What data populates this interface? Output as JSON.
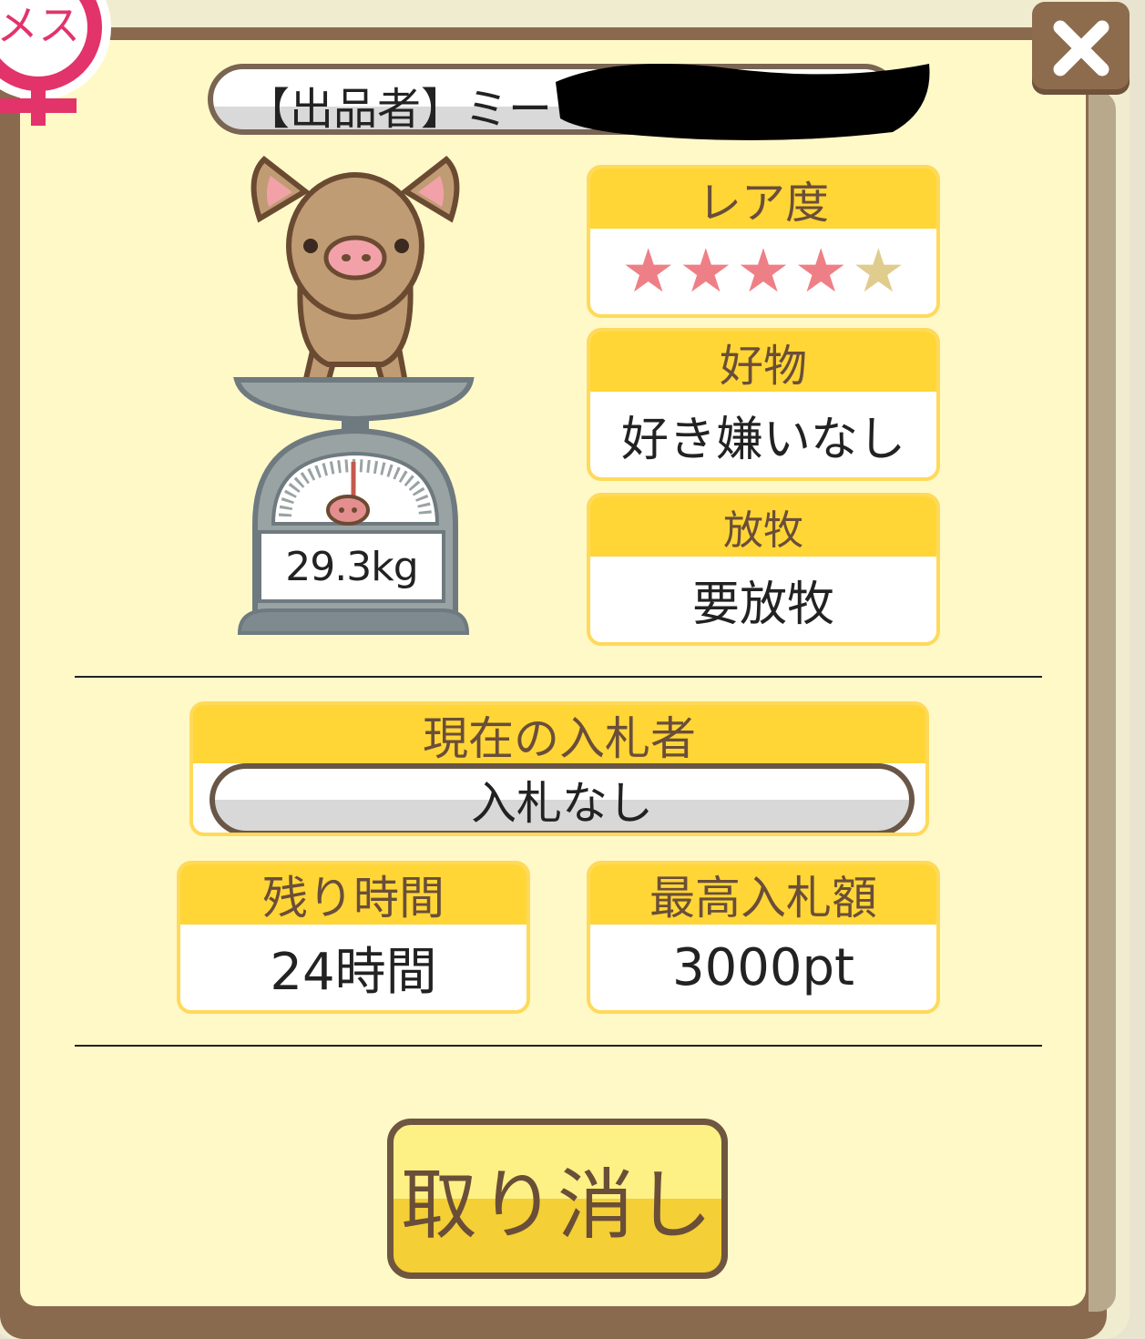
{
  "badge": {
    "label": "メス",
    "color": "#e2336a"
  },
  "seller": {
    "label": "【出品者】ミー"
  },
  "weight": "29.3kg",
  "rarity": {
    "label": "レア度",
    "filled": 4,
    "total": 5,
    "filled_color": "#ef7f86",
    "empty_color": "#e0cc8c"
  },
  "favorite": {
    "label": "好物",
    "value": "好き嫌いなし"
  },
  "grazing": {
    "label": "放牧",
    "value": "要放牧"
  },
  "bidder": {
    "label": "現在の入札者",
    "value": "入札なし"
  },
  "time_left": {
    "label": "残り時間",
    "value": "24時間"
  },
  "highest_bid": {
    "label": "最高入札額",
    "value": "3000pt"
  },
  "cancel_button": "取り消し",
  "colors": {
    "header": "#ffd635",
    "panel": "#fff9c8",
    "frame": "#8a6a4f"
  }
}
